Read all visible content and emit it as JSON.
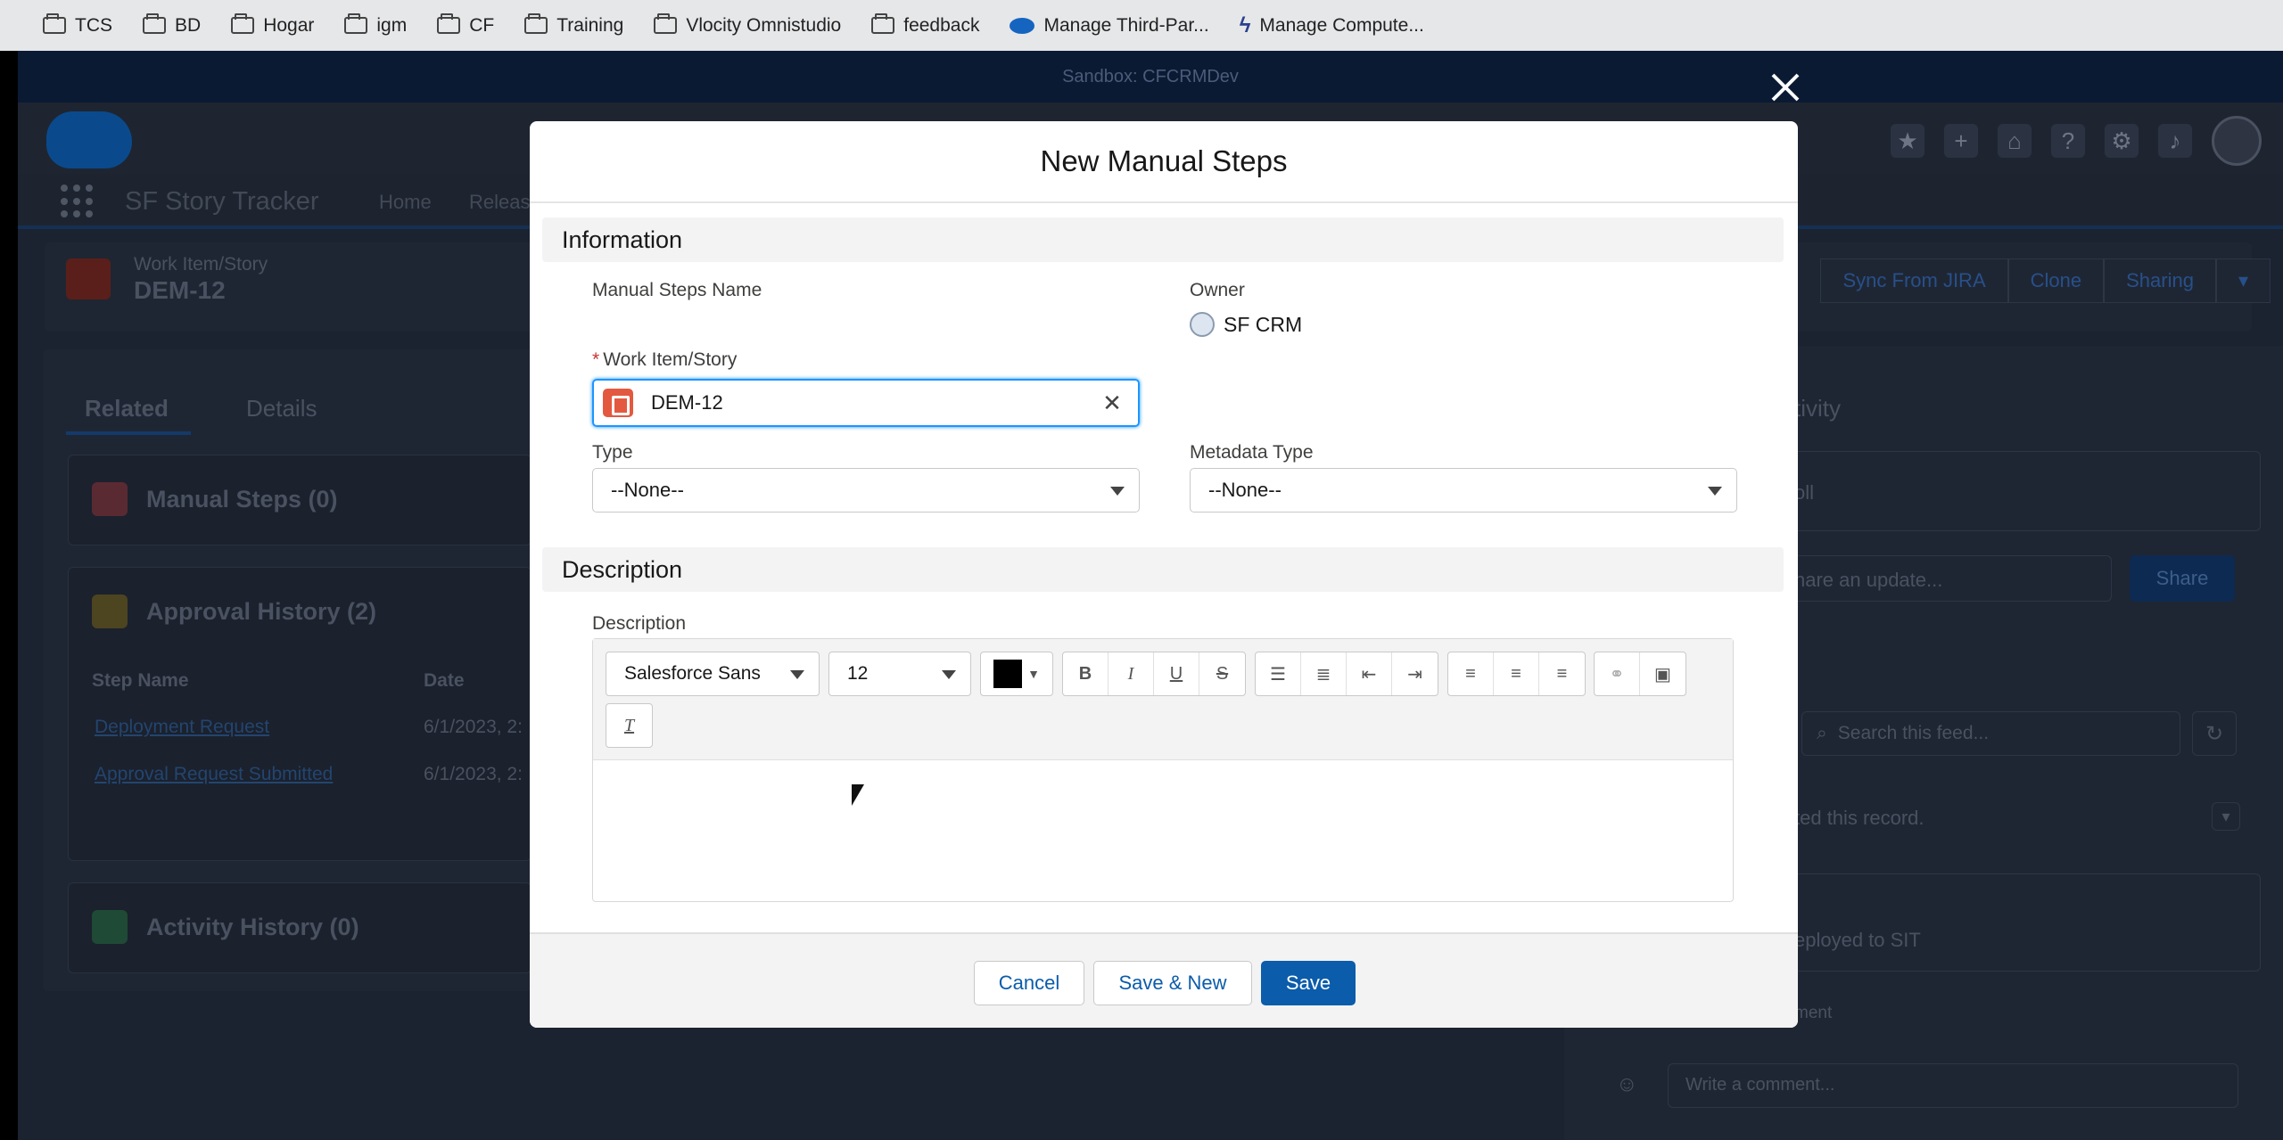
{
  "bookmarks": [
    {
      "label": "TCS",
      "icon": "folder"
    },
    {
      "label": "BD",
      "icon": "folder"
    },
    {
      "label": "Hogar",
      "icon": "folder"
    },
    {
      "label": "igm",
      "icon": "folder"
    },
    {
      "label": "CF",
      "icon": "folder"
    },
    {
      "label": "Training",
      "icon": "folder"
    },
    {
      "label": "Vlocity Omnistudio",
      "icon": "folder"
    },
    {
      "label": "feedback",
      "icon": "folder"
    },
    {
      "label": "Manage Third-Par...",
      "icon": "salesforce-cloud"
    },
    {
      "label": "Manage Compute...",
      "icon": "bolt"
    }
  ],
  "sandbox_label": "Sandbox: CFCRMDev",
  "app": {
    "name": "SF Story Tracker",
    "nav": [
      "Home",
      "Releas"
    ]
  },
  "record": {
    "type": "Work Item/Story",
    "name": "DEM-12",
    "actions": [
      "Sync From JIRA",
      "Clone",
      "Sharing"
    ]
  },
  "tabs": {
    "related": "Related",
    "details": "Details"
  },
  "related": {
    "manual_steps": "Manual Steps (0)",
    "approval_history": "Approval History (2)",
    "columns": [
      "Step Name",
      "Date"
    ],
    "rows": [
      {
        "step": "Deployment Request",
        "date": "6/1/2023, 2:"
      },
      {
        "step": "Approval Request Submitted",
        "date": "6/1/2023, 2:"
      }
    ],
    "activity_history": "Activity History (0)"
  },
  "activity": {
    "title": "tivity",
    "poll": "oll",
    "update_placeholder": "hare an update...",
    "share": "Share",
    "search_placeholder": "Search this feed...",
    "created": "ted this record.",
    "deployed": "eployed to SIT",
    "comment_label": "ment",
    "comment_placeholder": "Write a comment..."
  },
  "modal": {
    "title": "New Manual Steps",
    "section_information": "Information",
    "manual_steps_name_label": "Manual Steps Name",
    "owner_label": "Owner",
    "owner_value": "SF CRM",
    "work_item_label": "Work Item/Story",
    "work_item_value": "DEM-12",
    "type_label": "Type",
    "type_value": "--None--",
    "metadata_type_label": "Metadata Type",
    "metadata_type_value": "--None--",
    "section_description": "Description",
    "description_label": "Description",
    "font_family": "Salesforce Sans",
    "font_size": "12",
    "text_color": "#000000",
    "cancel": "Cancel",
    "save_new": "Save & New",
    "save": "Save"
  }
}
